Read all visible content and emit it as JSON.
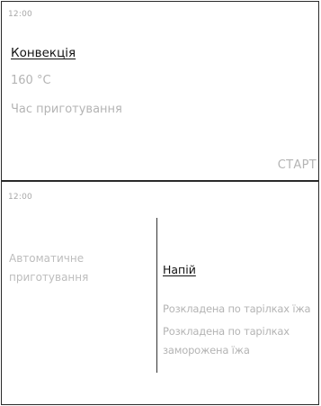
{
  "top_screen": {
    "clock": "12:00",
    "mode_name": "Конвекція",
    "temperature": "160 °C",
    "cook_time_label": "Час приготування",
    "start_label": "СТАРТ"
  },
  "bottom_screen": {
    "clock": "12:00",
    "category_label": "Автоматичне приготування",
    "programs": [
      "Напій",
      "Розкладена по тарілках їжа",
      "Розкладена по тарілках заморожена їжа"
    ],
    "selected_program_index": 0
  }
}
